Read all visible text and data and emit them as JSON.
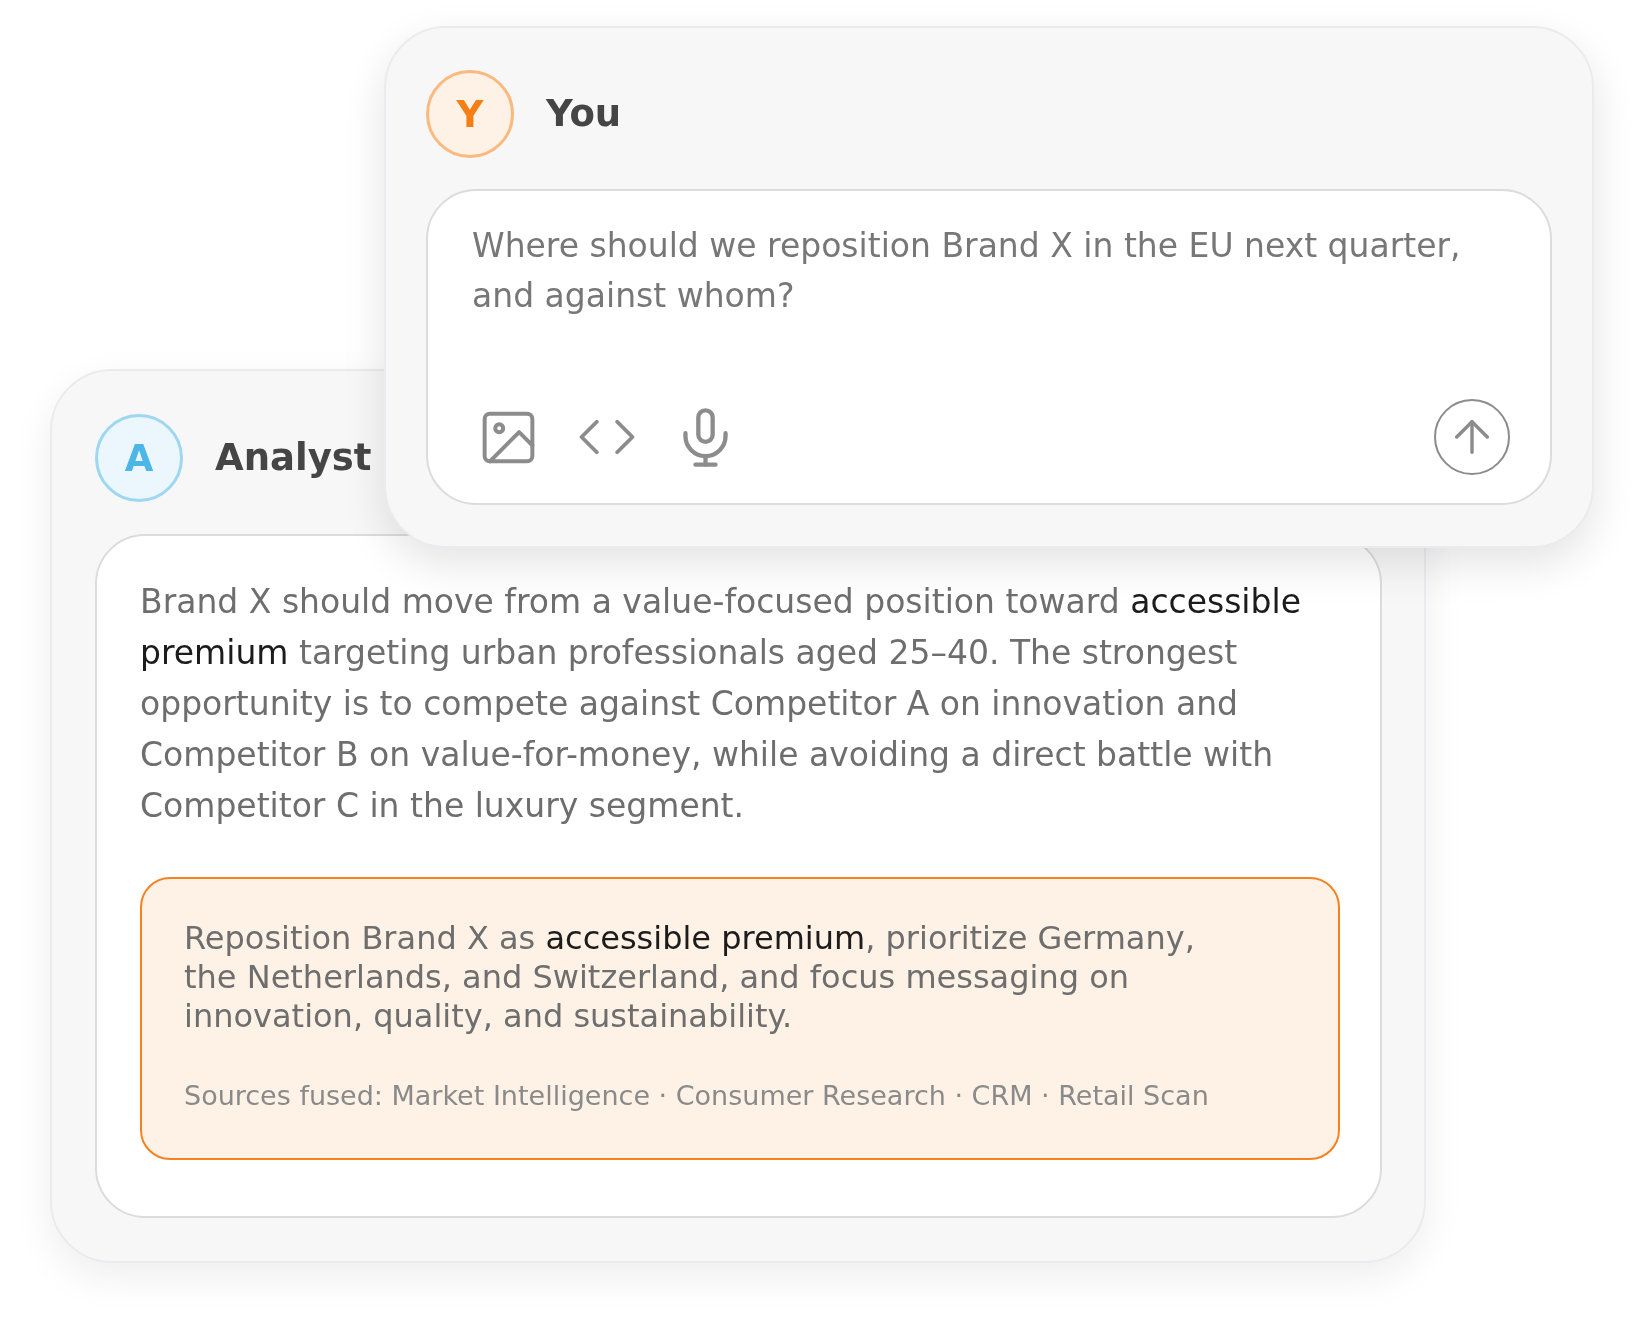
{
  "messages": [
    {
      "kind": "question",
      "author": "You",
      "initial": "Y",
      "color": "#f57f17",
      "text": "Where should we reposition Brand X in the EU next quarter, and against whom?"
    },
    {
      "kind": "answer",
      "author": "Analyst",
      "initial": "A",
      "color": "#4cb6e6",
      "text": "Brand X should move from a value-focused position toward **accessible premium** targeting urban professionals aged 25–40. The strongest opportunity is to compete against Competitor A on innovation and Competitor B on value-for-money, while avoiding a direct battle with Competitor C in the luxury segment.",
      "summary": {
        "text": "Reposition Brand X as **accessible premium**, prioritize Germany, the Netherlands, and Switzerland, and focus messaging on innovation, quality, and sustainability.",
        "sources": "Sources fused: Market Intelligence · Consumer Research · CRM · Retail Scan"
      }
    }
  ]
}
